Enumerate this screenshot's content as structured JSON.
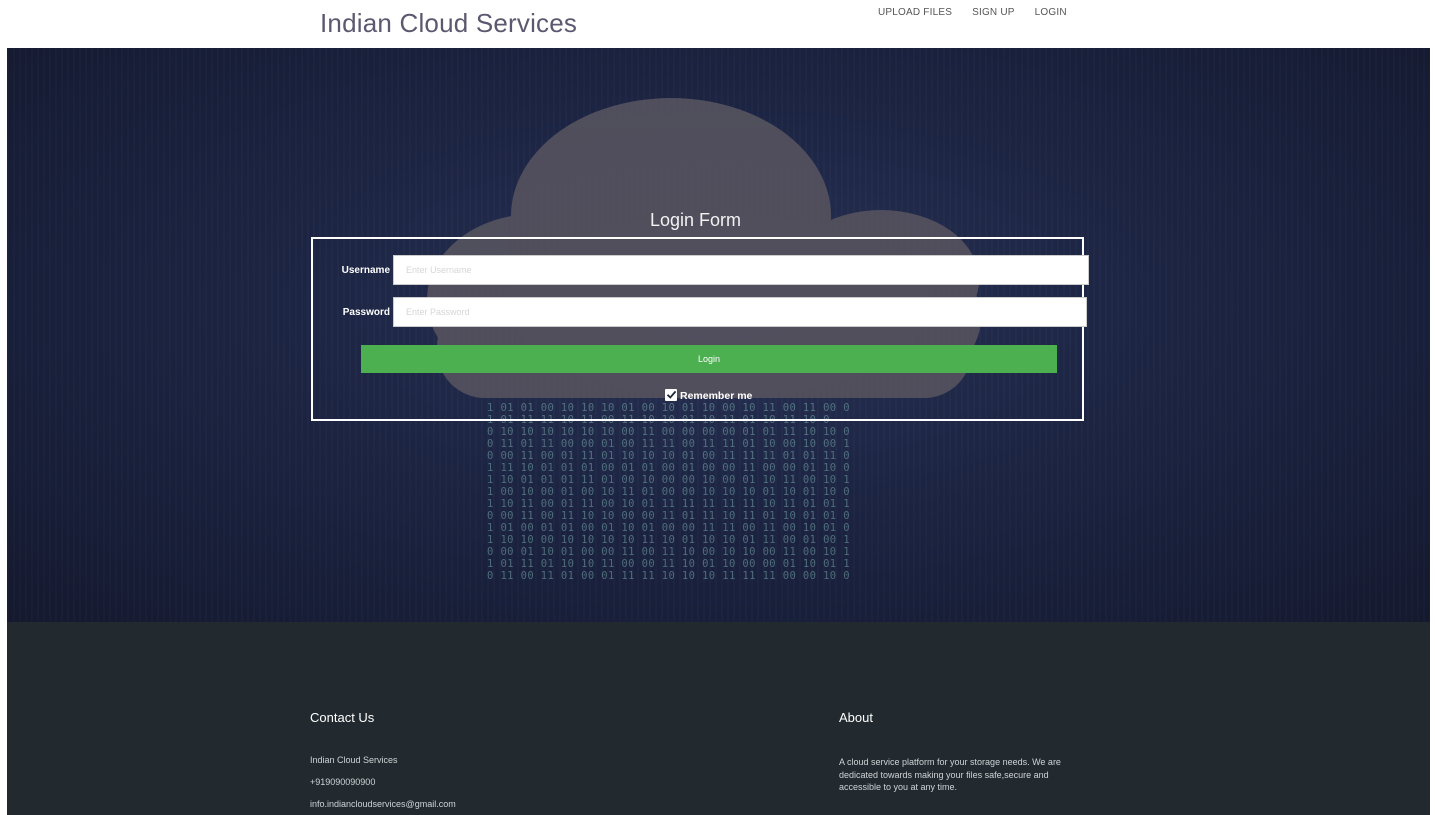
{
  "header": {
    "brand": "Indian Cloud Services",
    "nav": {
      "upload": "UPLOAD FILES",
      "signup": "SIGN UP",
      "login": "LOGIN"
    }
  },
  "hero": {
    "binary_lines": [
      "1 01 01 00 10 10 10 01 00 10 01 10 00 10 11 00 11 00 0",
      "1 01 11 11 10 11 00 11 10 10 01 10 11 01 10 11 10 0",
      "0 10 10 10 10 10 10 00 11 00 00 00 00 01 01 11 10 10 0",
      "0 11 01 11 00 00 01 00 11 11 00 11 11 01 10 00 10 00 1",
      "0 00 11 00 01 11 01 10 10 10 01 00 11 11 11 01 01 11 0",
      "1 11 10 01 01 01 00 01 01 00 01 00 00 11 00 00 01 10 0",
      "1 10 01 01 01 11 01 00 10 00 00 10 00 01 10 11 00 10 1",
      "1 00 10 00 01 00 10 11 01 00 00 10 10 10 01 10 01 10 0",
      "1 10 11 00 01 11 00 10 01 11 11 11 11 11 10 11 01 01 1",
      "0 00 11 00 11 10 10 00 00 11 01 11 10 11 01 10 01 01 0",
      "1 01 00 01 01 00 01 10 01 00 00 11 11 00 11 00 10 01 0",
      "1 10 10 00 10 10 10 10 11 10 01 10 10 01 11 00 01 00 1",
      "0 00 01 10 01 00 00 11 00 11 10 00 10 10 00 11 00 10 1",
      "1 01 11 01 10 10 11 00 00 11 10 01 10 00 00 01 10 01 1",
      "0 11 00 11 01 00 01 11 11 10 10 10 11 11 11 00 00 10 0"
    ]
  },
  "login_form": {
    "title": "Login Form",
    "username_label": "Username",
    "username_placeholder": "Enter Username",
    "username_value": "",
    "password_label": "Password",
    "password_placeholder": "Enter Password",
    "password_value": "",
    "submit_label": "Login",
    "remember_label": "Remember me",
    "remember_checked": true
  },
  "footer": {
    "contact": {
      "heading": "Contact Us",
      "company": "Indian Cloud Services",
      "phone": "+919090090900",
      "email": "info.indiancloudservices@gmail.com"
    },
    "about": {
      "heading": "About",
      "text": "A cloud service platform for your storage needs. We are dedicated towards making your files safe,secure and accessible to you at any time."
    }
  },
  "colors": {
    "brand_text": "#5c5870",
    "hero_bg": "#1d2545",
    "cloud": "#55525e",
    "login_button": "#4caf50",
    "footer_bg": "#222a2f"
  }
}
